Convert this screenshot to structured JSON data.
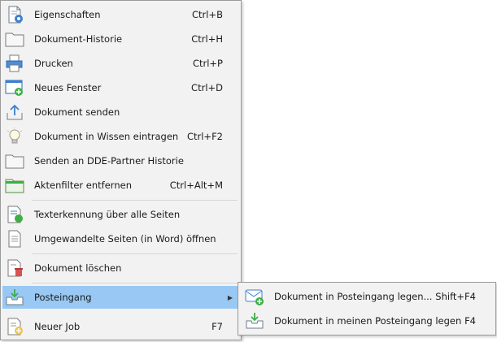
{
  "menu": {
    "items": [
      {
        "label": "Eigenschaften",
        "shortcut": "Ctrl+B",
        "icon": "properties-icon"
      },
      {
        "label": "Dokument-Historie",
        "shortcut": "Ctrl+H",
        "icon": "folder-icon"
      },
      {
        "label": "Drucken",
        "shortcut": "Ctrl+P",
        "icon": "printer-icon"
      },
      {
        "label": "Neues Fenster",
        "shortcut": "Ctrl+D",
        "icon": "new-window-icon"
      },
      {
        "label": "Dokument senden",
        "shortcut": "",
        "icon": "send-document-icon"
      },
      {
        "label": "Dokument in Wissen eintragen",
        "shortcut": "Ctrl+F2",
        "icon": "lightbulb-icon"
      },
      {
        "label": "Senden an DDE-Partner Historie",
        "shortcut": "",
        "icon": "folder-icon"
      },
      {
        "label": "Aktenfilter entfernen",
        "shortcut": "Ctrl+Alt+M",
        "icon": "green-folder-icon"
      },
      {
        "label": "Texterkennung über alle Seiten",
        "shortcut": "",
        "icon": "ocr-icon"
      },
      {
        "label": "Umgewandelte Seiten (in Word) öffnen",
        "shortcut": "",
        "icon": "document-icon"
      },
      {
        "label": "Dokument löschen",
        "shortcut": "",
        "icon": "delete-document-icon"
      },
      {
        "label": "Posteingang",
        "shortcut": "",
        "icon": "inbox-icon",
        "submenu_arrow": "▶",
        "highlighted": true
      },
      {
        "label": "Neuer Job",
        "shortcut": "F7",
        "icon": "new-job-icon"
      }
    ]
  },
  "submenu": {
    "items": [
      {
        "label": "Dokument in Posteingang legen...",
        "shortcut": "Shift+F4",
        "icon": "mail-add-icon"
      },
      {
        "label": "Dokument in meinen Posteingang legen",
        "shortcut": "F4",
        "icon": "inbox-download-icon"
      }
    ]
  },
  "colors": {
    "menu_background": "#f2f2f2",
    "highlight": "#98c8f3",
    "border": "#9a9a9a",
    "text": "#1a1a1a"
  }
}
